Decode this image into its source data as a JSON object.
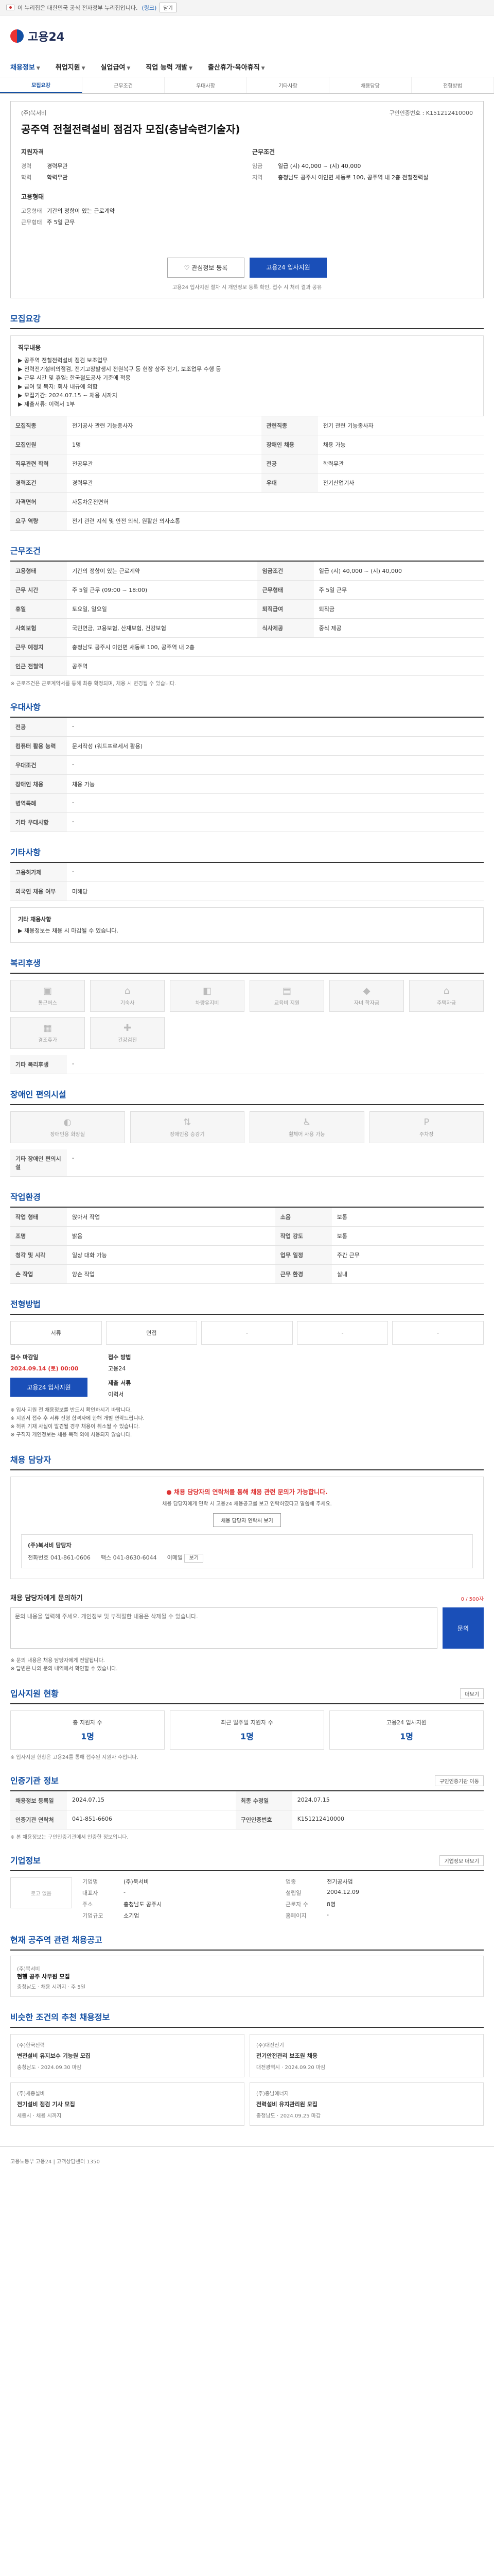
{
  "topbar": {
    "notice": "이 누리집은 대한민국 공식 전자정부 누리집입니다.",
    "link": "(링크)",
    "close": "닫기"
  },
  "brand": {
    "logo_text": "고용24"
  },
  "gnb": [
    {
      "label": "채용정보"
    },
    {
      "label": "취업지원"
    },
    {
      "label": "실업급여"
    },
    {
      "label": "직업 능력 개발"
    },
    {
      "label": "출산휴가·육아휴직"
    }
  ],
  "subtabs": [
    {
      "label": "모집요강"
    },
    {
      "label": "근무조건"
    },
    {
      "label": "우대사항"
    },
    {
      "label": "기타사항"
    },
    {
      "label": "채용담당"
    },
    {
      "label": "전형방법"
    }
  ],
  "job": {
    "company": "(주)북서비",
    "reg_no": "구인인증번호 : K151212410000",
    "title": "공주역 전철전력설비 점검자 모집(충남숙련기술자)"
  },
  "summary": {
    "left_head": "지원자격",
    "left_rows": [
      {
        "k": "경력",
        "v": "경력무관"
      },
      {
        "k": "학력",
        "v": "학력무관"
      }
    ],
    "left_head2": "고용형태",
    "left_rows2": [
      {
        "k": "고용형태",
        "v": "기간의 정함이 있는 근로계약"
      },
      {
        "k": "근무형태",
        "v": "주 5일 근무"
      }
    ],
    "right_head": "근무조건",
    "right_rows": [
      {
        "k": "임금",
        "v": "일급 (시) 40,000 ~ (시) 40,000"
      },
      {
        "k": "지역",
        "v": "충청남도 공주시 이인면 새동로 100, 공주역 내 2층 전철전력실"
      }
    ]
  },
  "actions": {
    "scrap": "관심정보 등록",
    "apply": "고용24 입사지원",
    "note": "고용24 입사지원 절차 시 개인정보 등록 확인, 접수 시 처리 결과 공유"
  },
  "recruit": {
    "section": "모집요강",
    "duty_head": "직무내용",
    "duty_text": "▶ 공주역 전철전력설비 점검 보조업무\n▶ 전력전기설비의점검, 전기고장발생시 전원복구 등 현장 상주 전기, 보조업무 수행 등\n▶ 근무 시간 및 휴일: 한국철도공사 기준에 적용\n▶ 급여 및 복지: 회사 내규에 의함\n▶ 모집기간: 2024.07.15 ~ 채용 시까지\n▶ 제출서류: 이력서 1부",
    "rows": [
      {
        "h": "모집직종",
        "v": "전기공사 관련 기능종사자",
        "h2": "관련직종",
        "v2": "전기 관련 기능종사자"
      },
      {
        "h": "모집인원",
        "v": "1명",
        "h2": "장애인 채용",
        "v2": "채용 가능"
      },
      {
        "h": "직무관련 학력",
        "v": "전공무관",
        "h2": "전공",
        "v2": "학력무관"
      },
      {
        "h": "경력조건",
        "v": "경력무관",
        "h2": "우대",
        "v2": "전기산업기사"
      },
      {
        "h": "자격면허",
        "v": "자동차운전면허",
        "h2": "",
        "v2": ""
      },
      {
        "h": "요구 역량",
        "v": "전기 관련 지식 및 안전 의식, 원활한 의사소통",
        "h2": "",
        "v2": ""
      }
    ]
  },
  "work": {
    "section": "근무조건",
    "rows": [
      {
        "h": "고용형태",
        "v": "기간의 정함이 있는 근로계약",
        "h2": "임금조건",
        "v2": "일급 (시) 40,000 ~ (시) 40,000"
      },
      {
        "h": "근무 시간",
        "v": "주 5일 근무 (09:00 ~ 18:00)",
        "h2": "근무형태",
        "v2": "주 5일 근무"
      },
      {
        "h": "휴일",
        "v": "토요일, 일요일",
        "h2": "퇴직급여",
        "v2": "퇴직금"
      },
      {
        "h": "사회보험",
        "v": "국민연금, 고용보험, 산재보험, 건강보험",
        "h2": "식사제공",
        "v2": "중식 제공"
      },
      {
        "h": "근무 예정지",
        "v": "충청남도 공주시 이인면 새동로 100, 공주역 내 2층",
        "h2": "",
        "v2": ""
      },
      {
        "h": "인근 전철역",
        "v": "공주역",
        "h2": "",
        "v2": ""
      }
    ],
    "note": "※ 근로조건은 근로계약서를 통해 최종 확정되며, 채용 시 변경될 수 있습니다."
  },
  "pref": {
    "section": "우대사항",
    "rows": [
      {
        "h": "전공",
        "v": "-"
      },
      {
        "h": "컴퓨터 활용 능력",
        "v": "문서작성 (워드프로세서 활용)"
      },
      {
        "h": "우대조건",
        "v": "-"
      },
      {
        "h": "장애인 채용",
        "v": "채용 가능"
      },
      {
        "h": "병역특례",
        "v": "-"
      },
      {
        "h": "기타 우대사항",
        "v": "-"
      }
    ]
  },
  "etc": {
    "section": "기타사항",
    "rows": [
      {
        "h": "고용허가제",
        "v": "-"
      },
      {
        "h": "외국인 채용 여부",
        "v": "미해당"
      }
    ],
    "extra_head": "기타 채용사항",
    "extra_text": "▶ 채용정보는 채용 시 마감될 수 있습니다."
  },
  "welfare": {
    "section": "복리후생",
    "items": [
      {
        "label": "통근버스",
        "icon": "bus-icon"
      },
      {
        "label": "기숙사",
        "icon": "home-icon"
      },
      {
        "label": "차량유지비",
        "icon": "car-icon"
      },
      {
        "label": "교육비 지원",
        "icon": "book-icon"
      },
      {
        "label": "자녀 학자금",
        "icon": "cap-icon"
      },
      {
        "label": "주택자금",
        "icon": "house-icon"
      },
      {
        "label": "경조휴가",
        "icon": "calendar-icon"
      },
      {
        "label": "건강검진",
        "icon": "medical-icon"
      }
    ],
    "other_label": "기타 복리후생",
    "other_value": "-"
  },
  "disability": {
    "section": "장애인 편의시설",
    "items": [
      {
        "label": "장애인용 화장실",
        "icon": "toilet-icon"
      },
      {
        "label": "장애인용 승강기",
        "icon": "elevator-icon"
      },
      {
        "label": "휠체어 사용 가능",
        "icon": "wheelchair-icon"
      },
      {
        "label": "주차장",
        "icon": "parking-icon"
      }
    ],
    "other_label": "기타 장애인 편의시설",
    "other_value": "-"
  },
  "workenv": {
    "section": "작업환경",
    "rows": [
      {
        "h": "작업 형태",
        "v": "앉아서 작업",
        "h2": "소음",
        "v2": "보통"
      },
      {
        "h": "조명",
        "v": "밝음",
        "h2": "작업 강도",
        "v2": "보통"
      },
      {
        "h": "청각 및 시각",
        "v": "일상 대화 가능",
        "h2": "업무 일정",
        "v2": "주간 근무"
      },
      {
        "h": "손 작업",
        "v": "양손 작업",
        "h2": "근무 환경",
        "v2": "실내"
      }
    ]
  },
  "process": {
    "section": "전형방법",
    "steps": [
      {
        "label": "서류",
        "active": true
      },
      {
        "label": "면접",
        "active": true
      },
      {
        "label": "-",
        "active": false
      },
      {
        "label": "-",
        "active": false
      },
      {
        "label": "-",
        "active": false
      }
    ],
    "deadline_label": "접수 마감일",
    "deadline_value": "2024.09.14 (토) 00:00",
    "method_label": "접수 방법",
    "method_value": "고용24",
    "docs_label": "제출 서류",
    "docs_value": "이력서",
    "apply_btn": "고용24 입사지원",
    "bullets": [
      "※ 입사 지원 전 채용정보를 반드시 확인하시기 바랍니다.",
      "※ 지원서 접수 후 서류 전형 합격자에 한해 개별 연락드립니다.",
      "※ 허위 기재 사실이 발견될 경우 채용이 취소될 수 있습니다.",
      "※ 구직자 개인정보는 채용 목적 외에 사용되지 않습니다."
    ]
  },
  "manager": {
    "section": "채용 담당자",
    "warn": "채용 담당자의 연락처를 통해 채용 관련 문의가 가능합니다.",
    "note": "채용 담당자에게 연락 시 고용24 채용공고를 보고 연락하였다고 말씀해 주세요.",
    "contact_btn": "채용 담당자 연락처 보기",
    "card_name": "(주)북서비 담당자",
    "phone_label": "전화번호",
    "phone": "041-861-0606",
    "fax_label": "팩스",
    "fax": "041-8630-6044",
    "email_label": "이메일",
    "email_btn": "보기"
  },
  "inquiry": {
    "section": "채용 담당자에게 문의하기",
    "limit": "0 / 500자",
    "placeholder": "문의 내용을 입력해 주세요. 개인정보 및 부적절한 내용은 삭제될 수 있습니다.",
    "send": "문의",
    "bullets": [
      "※ 문의 내용은 채용 담당자에게 전달됩니다.",
      "※ 답변은 나의 문의 내역에서 확인할 수 있습니다."
    ]
  },
  "applicants": {
    "section": "입사지원 현황",
    "more": "더보기",
    "stats": [
      {
        "label": "총 지원자 수",
        "value": "1명"
      },
      {
        "label": "최근 일주일 지원자 수",
        "value": "1명"
      },
      {
        "label": "고용24 입사지원",
        "value": "1명"
      }
    ],
    "note": "※ 입사지원 현황은 고용24를 통해 접수된 지원자 수입니다."
  },
  "info": {
    "section": "인증기관 정보",
    "more": "구인인증기관 이동",
    "rows": [
      {
        "h": "채용정보 등록일",
        "v": "2024.07.15",
        "h2": "최종 수정일",
        "v2": "2024.07.15"
      },
      {
        "h": "인증기관 연락처",
        "v": "041-851-6606",
        "h2": "구인인증번호",
        "v2": "K151212410000"
      }
    ],
    "note": "※ 본 채용정보는 구인인증기관에서 인증한 정보입니다."
  },
  "companyinfo": {
    "section": "기업정보",
    "more": "기업정보 더보기",
    "logo": "로고 없음",
    "rows": [
      {
        "k": "기업명",
        "v": "(주)북서비",
        "k2": "업종",
        "v2": "전기공사업"
      },
      {
        "k": "대표자",
        "v": "-",
        "k2": "설립일",
        "v2": "2004.12.09"
      },
      {
        "k": "주소",
        "v": "충청남도 공주시",
        "k2": "근로자 수",
        "v2": "8명"
      },
      {
        "k": "기업규모",
        "v": "소기업",
        "k2": "홈페이지",
        "v2": "-"
      }
    ]
  },
  "related": {
    "section": "현재 공주역 관련 채용공고",
    "items": [
      {
        "company": "(주)북서비",
        "title": "현행 공주 사무원 모집",
        "meta": "충청남도 · 채용 시까지 · 주 5일"
      }
    ]
  },
  "similar": {
    "section": "비슷한 조건의 추천 채용정보",
    "items": [
      {
        "company": "(주)한국전력",
        "title": "변전설비 유지보수 기능원 모집",
        "meta": "충청남도 · 2024.09.30 마감"
      },
      {
        "company": "(주)대전전기",
        "title": "전기안전관리 보조원 채용",
        "meta": "대전광역시 · 2024.09.20 마감"
      },
      {
        "company": "(주)세종설비",
        "title": "전기설비 점검 기사 모집",
        "meta": "세종시 · 채용 시까지"
      },
      {
        "company": "(주)충남에너지",
        "title": "전력설비 유지관리원 모집",
        "meta": "충청남도 · 2024.09.25 마감"
      }
    ]
  },
  "footer": {
    "text": "고용노동부 고용24 | 고객상담센터 1350"
  }
}
